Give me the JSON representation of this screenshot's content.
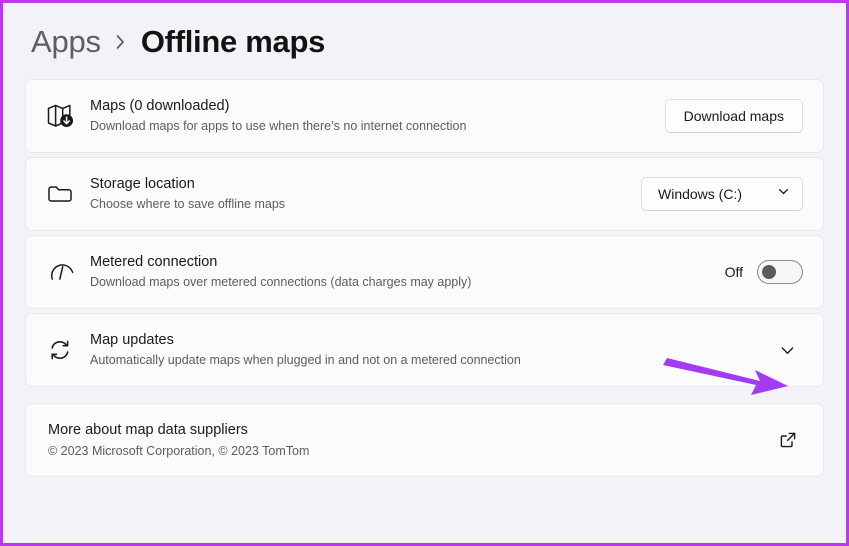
{
  "window": {
    "breadcrumb": {
      "parent": "Apps",
      "separator": "›",
      "current": "Offline maps"
    },
    "background_color": "#f3f3f7",
    "border_color": "#b93af0"
  },
  "settings_rows": [
    {
      "icon": "map-download-icon",
      "title": "Maps (0 downloaded)",
      "subtitle": "Download maps for apps to use when there’s no internet connection",
      "action": {
        "type": "button",
        "label": "Download maps"
      }
    },
    {
      "icon": "folder-icon",
      "title": "Storage location",
      "subtitle": "Choose where to save offline maps",
      "action": {
        "type": "dropdown",
        "value": "Windows (C:)",
        "chevron": "chevron-down-icon"
      }
    },
    {
      "icon": "gauge-icon",
      "title": "Metered connection",
      "subtitle": "Download maps over metered connections (data charges may apply)",
      "action": {
        "type": "toggle",
        "state_label": "Off",
        "checked": false
      }
    },
    {
      "icon": "sync-refresh-icon",
      "title": "Map updates",
      "subtitle": "Automatically update maps when plugged in and not on a metered connection",
      "action": {
        "type": "expander",
        "chevron": "chevron-down-icon"
      }
    }
  ],
  "footer_link": {
    "title": "More about map data suppliers",
    "subtitle": "© 2023 Microsoft Corporation, © 2023 TomTom",
    "icon": "external-link-icon"
  },
  "annotation": {
    "type": "arrow",
    "color": "#a33bf5",
    "description": "purple arrow pointing to map updates expander chevron"
  }
}
